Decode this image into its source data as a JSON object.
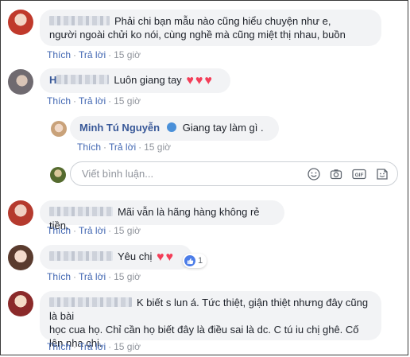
{
  "comments": [
    {
      "text_line1": "Phải chi bạn mẫu nào cũng hiểu chuyện như e,",
      "text_line2": "người ngoài chửi ko nói, cùng nghề mà cũng miệt thị nhau, buồn",
      "actions": {
        "like": "Thích",
        "reply": "Trả lời",
        "time": "15 giờ"
      }
    },
    {
      "name_initial": "H",
      "text": "Luôn giang tay",
      "actions": {
        "like": "Thích",
        "reply": "Trả lời",
        "time": "15 giờ"
      }
    },
    {
      "name": "Minh Tú Nguyễn",
      "text": "Giang tay làm gì .",
      "actions": {
        "like": "Thích",
        "reply": "Trả lời",
        "time": "15 giờ"
      }
    },
    {
      "text": "Mãi vẫn là hãng hàng không rẻ tiền.",
      "actions": {
        "like": "Thích",
        "reply": "Trả lời",
        "time": "15 giờ"
      }
    },
    {
      "text": "Yêu chị",
      "reaction_count": "1",
      "actions": {
        "like": "Thích",
        "reply": "Trả lời",
        "time": "15 giờ"
      }
    },
    {
      "text_line1": "K biết s lun á. Tức thiệt, giận thiệt nhưng đây cũng là bài",
      "text_line2": "học cua họ. Chỉ cần họ biết đây là điều sai là dc. C tú iu chị ghê. Cố",
      "text_line3": "lên nha chị.",
      "actions": {
        "like": "Thích",
        "reply": "Trả lời",
        "time": "15 giờ"
      }
    }
  ],
  "reply_box": {
    "placeholder": "Viết bình luận...",
    "tools": [
      "emoji-icon",
      "camera-icon",
      "gif-icon",
      "sticker-icon"
    ]
  },
  "colors": {
    "link": "#4267b2",
    "name": "#385898",
    "bubble": "#f2f3f5",
    "heart": "#f33e58"
  }
}
